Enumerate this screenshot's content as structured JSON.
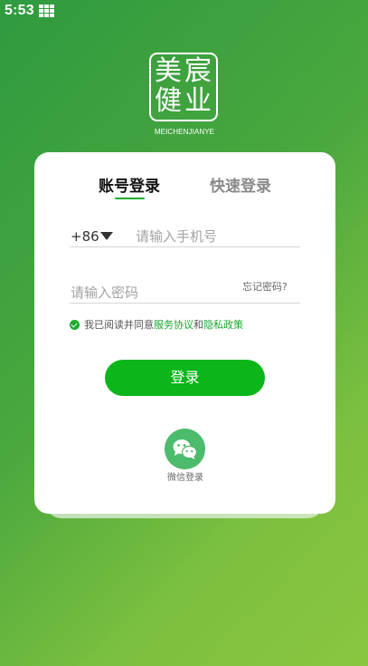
{
  "status_bar": {
    "time": "5:53",
    "icon": "app-grid-icon"
  },
  "logo": {
    "chars": [
      "美",
      "宸",
      "健",
      "业"
    ],
    "caption": "MEICHENJIANYE"
  },
  "tabs": [
    {
      "label": "账号登录",
      "active": true
    },
    {
      "label": "快速登录",
      "active": false
    }
  ],
  "phone": {
    "country_code": "+86",
    "placeholder": "请输入手机号",
    "value": ""
  },
  "password": {
    "placeholder": "请输入密码",
    "value": "",
    "forgot_label": "忘记密码?"
  },
  "agreement": {
    "checked": true,
    "prefix": "我已阅读并同意",
    "service_link": "服务协议",
    "and": "和",
    "privacy_link": "隐私政策"
  },
  "login_button": {
    "label": "登录"
  },
  "wechat": {
    "icon": "wechat-icon",
    "label": "微信登录"
  },
  "colors": {
    "accent": "#0bb51a",
    "link": "#16a82a",
    "wechat": "#4dbb6c",
    "background_start": "#2f9a3f",
    "background_end": "#8ac640"
  }
}
